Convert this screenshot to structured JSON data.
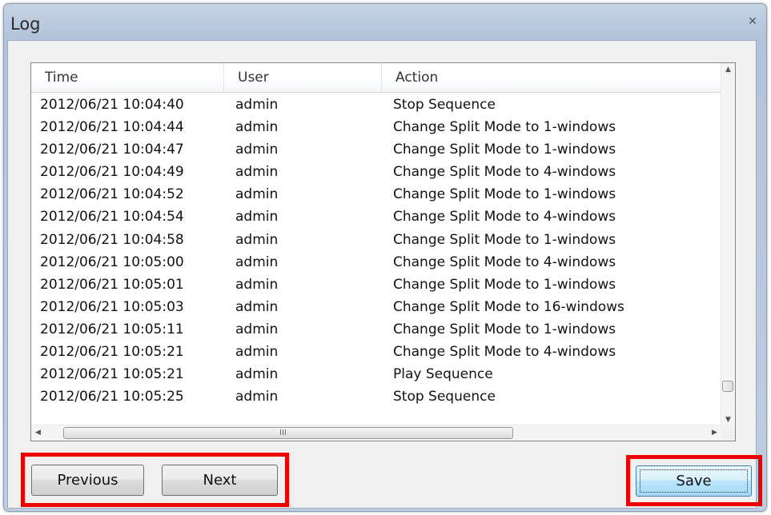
{
  "window": {
    "title": "Log",
    "close_glyph": "✕",
    "close_icon": "close-icon"
  },
  "table": {
    "columns": [
      "Time",
      "User",
      "Action"
    ],
    "rows": [
      {
        "time": "2012/06/21 10:04:40",
        "user": "admin",
        "action": "Stop Sequence"
      },
      {
        "time": "2012/06/21 10:04:44",
        "user": "admin",
        "action": "Change Split Mode to 1-windows"
      },
      {
        "time": "2012/06/21 10:04:47",
        "user": "admin",
        "action": "Change Split Mode to 1-windows"
      },
      {
        "time": "2012/06/21 10:04:49",
        "user": "admin",
        "action": "Change Split Mode to 4-windows"
      },
      {
        "time": "2012/06/21 10:04:52",
        "user": "admin",
        "action": "Change Split Mode to 1-windows"
      },
      {
        "time": "2012/06/21 10:04:54",
        "user": "admin",
        "action": "Change Split Mode to 4-windows"
      },
      {
        "time": "2012/06/21 10:04:58",
        "user": "admin",
        "action": "Change Split Mode to 1-windows"
      },
      {
        "time": "2012/06/21 10:05:00",
        "user": "admin",
        "action": "Change Split Mode to 4-windows"
      },
      {
        "time": "2012/06/21 10:05:01",
        "user": "admin",
        "action": "Change Split Mode to 1-windows"
      },
      {
        "time": "2012/06/21 10:05:03",
        "user": "admin",
        "action": "Change Split Mode to 16-windows"
      },
      {
        "time": "2012/06/21 10:05:11",
        "user": "admin",
        "action": "Change Split Mode to 1-windows"
      },
      {
        "time": "2012/06/21 10:05:21",
        "user": "admin",
        "action": "Change Split Mode to 4-windows"
      },
      {
        "time": "2012/06/21 10:05:21",
        "user": "admin",
        "action": "Play Sequence"
      },
      {
        "time": "2012/06/21 10:05:25",
        "user": "admin",
        "action": "Stop Sequence"
      }
    ]
  },
  "scrollbars": {
    "up_arrow": "▲",
    "down_arrow": "▼",
    "left_arrow": "◀",
    "right_arrow": "▶",
    "grip_glyph": "III",
    "vertical_position": 0.9
  },
  "buttons": {
    "previous": "Previous",
    "next": "Next",
    "save": "Save"
  },
  "colors": {
    "highlight": "#ee0000",
    "save_button_border": "#3c7fb1"
  }
}
